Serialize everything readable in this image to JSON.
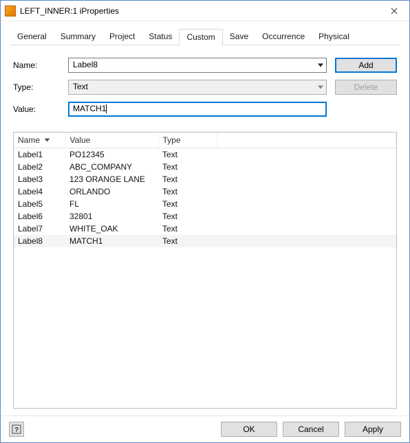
{
  "window": {
    "title": "LEFT_INNER:1 iProperties"
  },
  "tabs": {
    "general": "General",
    "summary": "Summary",
    "project": "Project",
    "status": "Status",
    "custom": "Custom",
    "save": "Save",
    "occurrence": "Occurrence",
    "physical": "Physical"
  },
  "form": {
    "name_label": "Name:",
    "name_value": "Label8",
    "type_label": "Type:",
    "type_value": "Text",
    "value_label": "Value:",
    "value_value": "MATCH1",
    "add_button": "Add",
    "delete_button": "Delete"
  },
  "table": {
    "columns": {
      "name": "Name",
      "value": "Value",
      "type": "Type"
    },
    "rows": [
      {
        "name": "Label1",
        "value": "PO12345",
        "type": "Text"
      },
      {
        "name": "Label2",
        "value": "ABC_COMPANY",
        "type": "Text"
      },
      {
        "name": "Label3",
        "value": "123 ORANGE LANE",
        "type": "Text"
      },
      {
        "name": "Label4",
        "value": "ORLANDO",
        "type": "Text"
      },
      {
        "name": "Label5",
        "value": "FL",
        "type": "Text"
      },
      {
        "name": "Label6",
        "value": "32801",
        "type": "Text"
      },
      {
        "name": "Label7",
        "value": "WHITE_OAK",
        "type": "Text"
      },
      {
        "name": "Label8",
        "value": "MATCH1",
        "type": "Text"
      }
    ],
    "selected_index": 7
  },
  "footer": {
    "ok": "OK",
    "cancel": "Cancel",
    "apply": "Apply"
  }
}
